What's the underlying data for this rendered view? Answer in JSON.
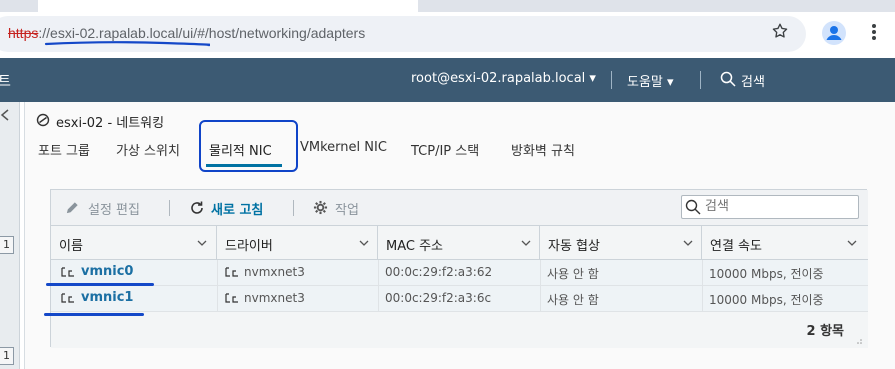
{
  "browser": {
    "url_scheme": "https",
    "url_rest": "://esxi-02.rapalab.local/ui/#/host/networking/adapters"
  },
  "header": {
    "app_title": "트",
    "user_menu": "root@esxi-02.rapalab.local ▾",
    "help_menu": "도움말 ▾",
    "search_label": "검색",
    "accent_color": "#3c5a73"
  },
  "sidebar": {
    "badge_1": "1",
    "badge_2": "1"
  },
  "page": {
    "title": "esxi-02 - 네트워킹",
    "tabs": [
      {
        "label": "포트 그룹"
      },
      {
        "label": "가상 스위치"
      },
      {
        "label": "물리적 NIC"
      },
      {
        "label": "VMkernel NIC"
      },
      {
        "label": "TCP/IP 스택"
      },
      {
        "label": "방화벽 규칙"
      }
    ]
  },
  "toolbar": {
    "edit_settings": "설정 편집",
    "refresh": "새로 고침",
    "actions": "작업",
    "search_placeholder": "검색"
  },
  "table": {
    "columns": [
      "이름",
      "드라이버",
      "MAC 주소",
      "자동 협상",
      "연결 속도"
    ],
    "rows": [
      {
        "name": "vmnic0",
        "driver": "nvmxnet3",
        "mac": "00:0c:29:f2:a3:62",
        "autoneg": "사용 안 함",
        "speed": "10000 Mbps, 전이중"
      },
      {
        "name": "vmnic1",
        "driver": "nvmxnet3",
        "mac": "00:0c:29:f2:a3:6c",
        "autoneg": "사용 안 함",
        "speed": "10000 Mbps, 전이중"
      }
    ],
    "item_count": "2 항목"
  }
}
